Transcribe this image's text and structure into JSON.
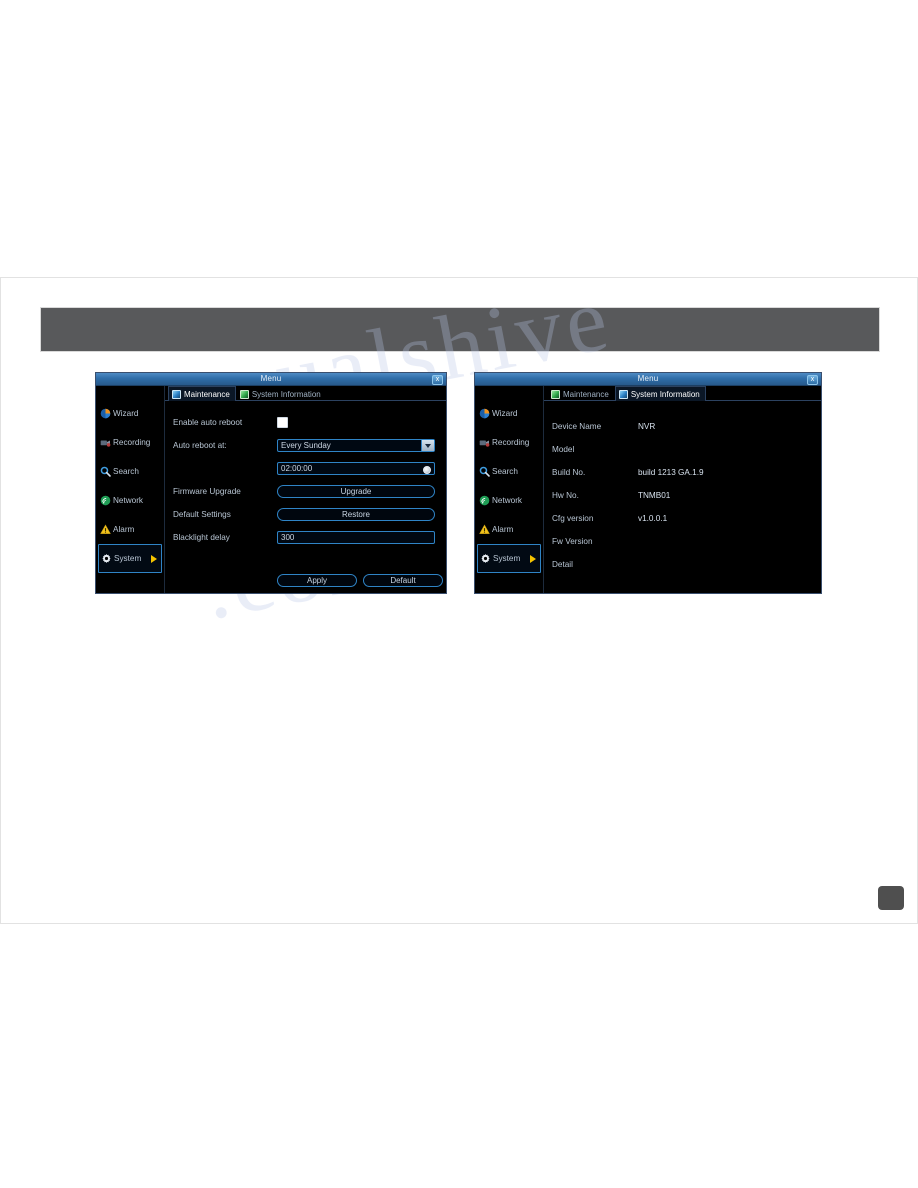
{
  "page": {
    "page_badge_label": "",
    "header_band_text": "",
    "watermark_line1": "manualshive",
    "watermark_line2": ".com"
  },
  "windows": [
    {
      "id": "maintenance-window",
      "title": "Menu",
      "close_label": "x",
      "sidebar": {
        "items": [
          {
            "label": "Wizard",
            "icon": "wizard-icon",
            "active": false
          },
          {
            "label": "Recording",
            "icon": "recording-icon",
            "active": false
          },
          {
            "label": "Search",
            "icon": "search-icon",
            "active": false
          },
          {
            "label": "Network",
            "icon": "network-icon",
            "active": false
          },
          {
            "label": "Alarm",
            "icon": "alarm-icon",
            "active": false
          },
          {
            "label": "System",
            "icon": "gear-icon",
            "active": true
          }
        ]
      },
      "tabs": [
        {
          "label": "Maintenance",
          "icon": "picture-icon-blue",
          "active": true
        },
        {
          "label": "System Information",
          "icon": "picture-icon-green",
          "active": false
        }
      ],
      "form": {
        "enable_auto_reboot_label": "Enable auto reboot",
        "enable_auto_reboot_checked": true,
        "auto_reboot_at_label": "Auto reboot at:",
        "auto_reboot_day_value": "Every Sunday",
        "auto_reboot_time_value": "02:00:00",
        "firmware_upgrade_label": "Firmware Upgrade",
        "firmware_upgrade_button": "Upgrade",
        "default_settings_label": "Default Settings",
        "default_settings_button": "Restore",
        "blacklight_delay_label": "Blacklight delay",
        "blacklight_delay_value": "300",
        "apply_button": "Apply",
        "default_button": "Default"
      }
    },
    {
      "id": "system-information-window",
      "title": "Menu",
      "close_label": "x",
      "sidebar": {
        "items": [
          {
            "label": "Wizard",
            "icon": "wizard-icon",
            "active": false
          },
          {
            "label": "Recording",
            "icon": "recording-icon",
            "active": false
          },
          {
            "label": "Search",
            "icon": "search-icon",
            "active": false
          },
          {
            "label": "Network",
            "icon": "network-icon",
            "active": false
          },
          {
            "label": "Alarm",
            "icon": "alarm-icon",
            "active": false
          },
          {
            "label": "System",
            "icon": "gear-icon",
            "active": true
          }
        ]
      },
      "tabs": [
        {
          "label": "Maintenance",
          "icon": "picture-icon-green",
          "active": false
        },
        {
          "label": "System Information",
          "icon": "picture-icon-blue",
          "active": true
        }
      ],
      "info_rows": [
        {
          "label": "Device Name",
          "value": "NVR"
        },
        {
          "label": "Model",
          "value": ""
        },
        {
          "label": "Build No.",
          "value": "build 1213 GA.1.9"
        },
        {
          "label": "Hw No.",
          "value": "TNMB01"
        },
        {
          "label": "Cfg version",
          "value": "v1.0.0.1"
        },
        {
          "label": "Fw Version",
          "value": ""
        },
        {
          "label": "Detail",
          "value": ""
        }
      ]
    }
  ],
  "colors": {
    "titlebar_blue": "#2f6da8",
    "accent_border": "#2f84c6",
    "panel_black": "#000000",
    "band_gray": "#58595b",
    "arrow_yellow": "#f5c400"
  }
}
